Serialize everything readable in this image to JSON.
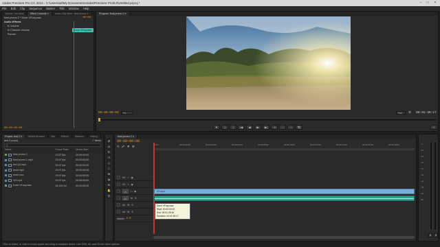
{
  "window": {
    "title": "Adobe Premiere Pro CC 2014 - C:\\Users\\ad\\My Documents\\Adobe\\Premiere Pro\\8.0\\Untitled.prproj *"
  },
  "menu": [
    "File",
    "Edit",
    "Clip",
    "Sequence",
    "Marker",
    "Title",
    "Window",
    "Help"
  ],
  "source_panel": {
    "tabs": [
      "Source: (no clips)",
      "Effect Controls ≡",
      "Audio Clip Mixer: final promo 2"
    ],
    "clip_header": "final promo 2 * Dove VFusy.wav",
    "timecode_top": "00:00",
    "clip_badge": "Dove VFusy.wav",
    "section": "Audio Effects",
    "effects": [
      "fx Volume",
      "fx Channel Volume",
      "Panner"
    ],
    "timecode": "00:00:00:00"
  },
  "program_monitor": {
    "tab": "Program: final promo 2 ≡",
    "timecode_left": "00:00:00:00",
    "fit": "Fit",
    "quality": "Full",
    "timecode_right": "00:01:39:17",
    "transport": [
      "▼",
      "{",
      "}",
      "|◀",
      "◀",
      "▶",
      "▶|",
      "⇥",
      "→",
      "↓",
      "📷",
      "+"
    ]
  },
  "project_panel": {
    "tabs": [
      "Project: test 2 ≡",
      "Media Browser",
      "Info",
      "Effects",
      "Markers",
      "History"
    ],
    "path": "test 2.prproj",
    "item_count": "7 Items",
    "search_placeholder": "",
    "columns": [
      "Name",
      "Frame Rate",
      "Media Start"
    ],
    "items": [
      {
        "name": "final promo 2",
        "fps": "23.97 fps",
        "start": "00:00:00:00",
        "color": "#4fae4f"
      },
      {
        "name": "final promo 1.mp4",
        "fps": "23.97 fps",
        "start": "00:00:00:00",
        "color": "#4a8fc8"
      },
      {
        "name": "text (2).mp4",
        "fps": "29.97 fps",
        "start": "00:00:00:00",
        "color": "#4a8fc8"
      },
      {
        "name": "test4.mp4",
        "fps": "29.97 fps",
        "start": "00:00:00:00",
        "color": "#4a8fc8"
      },
      {
        "name": "test4.mov",
        "fps": "29.97 fps",
        "start": "00:00:00:00",
        "color": "#4a8fc8"
      },
      {
        "name": "V/2.mp4",
        "fps": "29.97 fps",
        "start": "00:00:00:00",
        "color": "#4a8fc8"
      },
      {
        "name": "Dove VFusy.wav",
        "fps": "44,100 Hz",
        "start": "00:00:00:00",
        "color": "#2fb3a3"
      }
    ]
  },
  "timeline": {
    "tab": "final promo 2 ≡",
    "timecode": "00:00:00:00",
    "ruler": [
      "00:00",
      "00:00:02:00",
      "00:00:04:00",
      "00:00:06:00",
      "00:00:08:00",
      "00:00:10:00",
      "00:00:12:00",
      "00:00:14:00",
      "00:00:16:00",
      "00:00:18:00"
    ],
    "video_tracks": [
      "V3",
      "V2",
      "V1"
    ],
    "audio_tracks": [
      "A1",
      "A2",
      "A3"
    ],
    "master": "Master",
    "master_value": "0.0",
    "video_clip": "V2.mp4",
    "tooltip": {
      "name": "Dove VFusy.wav",
      "start": "Start: 00:00:00:00",
      "end": "End: 00:01:39:16",
      "duration": "Duration: 00:01:39:17"
    }
  },
  "meters": {
    "labels": [
      "-6",
      "-12",
      "-18",
      "-24",
      "-30",
      "-36",
      "-42",
      "-48",
      "-54",
      "dB"
    ],
    "buttons": [
      "S",
      "S"
    ]
  },
  "status_bar": "Click to select, or click in empty space and drag to marquee select. Use Shift, Alt, and Ctrl for other options.",
  "colors": {
    "accent": "#e0a020",
    "video_clip": "#7ab0d8",
    "audio_clip": "#2f9e8a",
    "playhead": "#d23030",
    "badge": "#3fc0b0"
  }
}
